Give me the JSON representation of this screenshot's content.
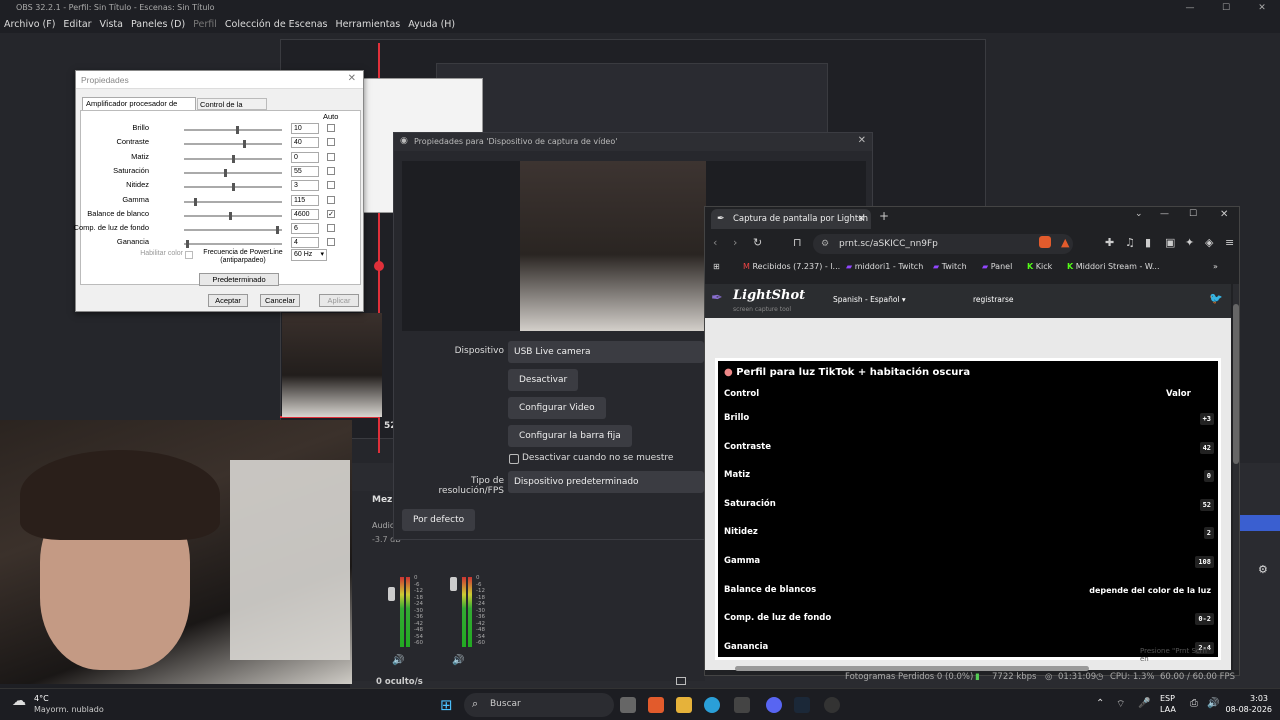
{
  "obs": {
    "title": "OBS 32.2.1 - Perfil: Sin Título - Escenas: Sin Título",
    "menu": [
      "Archivo (F)",
      "Editar",
      "Vista",
      "Paneles (D)",
      "Perfil",
      "Colección de Escenas",
      "Herramientas",
      "Ayuda (H)"
    ],
    "hidden_count": "0 oculto/s",
    "mixer_title": "Mez",
    "audio_label": "Audio",
    "audio_db": "-3.7 dB",
    "meter_ticks": [
      "0",
      "-6",
      "-12",
      "-18",
      "-24",
      "-30",
      "-36",
      "-42",
      "-48",
      "-54",
      "-60"
    ]
  },
  "props_dialog": {
    "title": "Propiedades",
    "tabs": [
      "Amplificador procesador de vídeo",
      "Control de la cámara"
    ],
    "auto_header": "Auto",
    "rows": [
      {
        "label": "Brillo",
        "value": "10",
        "pos": 0.55,
        "auto": false
      },
      {
        "label": "Contraste",
        "value": "40",
        "pos": 0.62,
        "auto": false
      },
      {
        "label": "Matiz",
        "value": "0",
        "pos": 0.5,
        "auto": false
      },
      {
        "label": "Saturación",
        "value": "55",
        "pos": 0.42,
        "auto": false
      },
      {
        "label": "Nitidez",
        "value": "3",
        "pos": 0.5,
        "auto": false
      },
      {
        "label": "Gamma",
        "value": "115",
        "pos": 0.1,
        "auto": false
      },
      {
        "label": "Balance de blanco",
        "value": "4600",
        "pos": 0.47,
        "auto": true
      },
      {
        "label": "Comp. de luz de fondo",
        "value": "6",
        "pos": 0.97,
        "auto": false
      },
      {
        "label": "Ganancia",
        "value": "4",
        "pos": 0.02,
        "auto": false
      }
    ],
    "color_enable": "Habilitar color",
    "powerline_label": "Frecuencia de PowerLine (antiparpadeo)",
    "powerline_value": "60 Hz",
    "default_button": "Predeterminado",
    "accept_button": "Aceptar",
    "cancel_button": "Cancelar",
    "apply_button": "Aplicar"
  },
  "dark_dialog": {
    "title": "Propiedades para 'Dispositivo de captura de vídeo'",
    "device_label": "Dispositivo",
    "device_value": "USB Live camera",
    "deactivate_button": "Desactivar",
    "configure_video_button": "Configurar Video",
    "configure_crossbar_button": "Configurar la barra fija",
    "deactivate_when_hidden": "Desactivar cuando no se muestre",
    "resolution_label": "Tipo de resolución/FPS",
    "resolution_value": "Dispositivo predeterminado",
    "defaults_button": "Por defecto"
  },
  "browser": {
    "tab_title": "Captura de pantalla por Lightsh",
    "url": "prnt.sc/aSKICC_nn9Fp",
    "bookmarks": [
      "Recibidos (7.237) - l...",
      "middori1 - Twitch",
      "Twitch",
      "Panel",
      "Kick",
      "Middori Stream - W..."
    ],
    "lightshot_logo": "LightShot",
    "lightshot_tagline": "screen capture tool",
    "language": "Spanish - Español",
    "register": "registrarse",
    "image_title": "Perfil para luz TikTok + habitación oscura",
    "col_control": "Control",
    "col_value": "Valor",
    "rows": [
      {
        "label": "Brillo",
        "value": "+3"
      },
      {
        "label": "Contraste",
        "value": "42"
      },
      {
        "label": "Matiz",
        "value": "0"
      },
      {
        "label": "Saturación",
        "value": "52"
      },
      {
        "label": "Nitidez",
        "value": "2"
      },
      {
        "label": "Gamma",
        "value": "108"
      },
      {
        "label": "Balance de blancos",
        "value": "depende del color de la luz"
      },
      {
        "label": "Comp. de luz de fondo",
        "value": "0-2"
      },
      {
        "label": "Ganancia",
        "value": "2-4"
      }
    ],
    "overlay_hint": "Presione \"Prnt Scrn\" en"
  },
  "status": {
    "frames_dropped": "Fotogramas Perdidos 0 (0.0%)",
    "bitrate": "7722 kbps",
    "time": "01:31:09",
    "cpu": "CPU: 1.3%",
    "fps": "60.00 / 60.00 FPS"
  },
  "taskbar": {
    "weather_temp": "4°C",
    "weather_desc": "Mayorm. nublado",
    "search_placeholder": "Buscar",
    "lang": "ESP",
    "lang_sub": "LAA",
    "clock_time": "3:03",
    "clock_date": "08-08-2026"
  }
}
